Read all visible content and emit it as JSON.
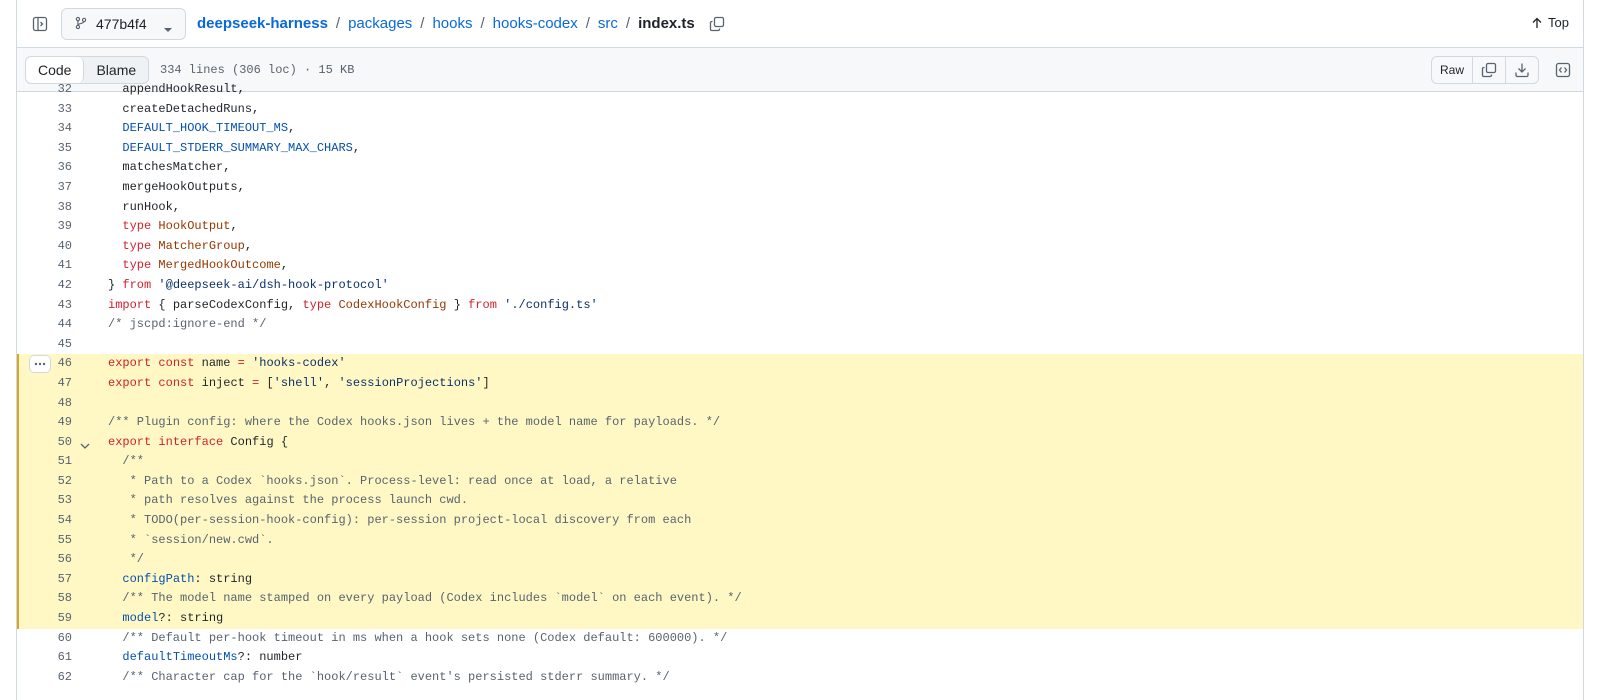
{
  "repo": "deepseek-harness",
  "branch": "477b4f4",
  "breadcrumbs": [
    "packages",
    "hooks",
    "hooks-codex",
    "src"
  ],
  "current_file": "index.ts",
  "top_label": "Top",
  "tabs": [
    "Code",
    "Blame"
  ],
  "file_info": "334 lines (306 loc) · 15 KB",
  "raw_label": "Raw",
  "colors": {
    "keyword": "#cf222e",
    "constant": "#0550ae",
    "type": "#953800",
    "string": "#0a3069",
    "comment": "#59636e",
    "highlight_bg": "#fff8c5",
    "link": "#0969da"
  },
  "icons": [
    "sidebar-collapse-icon",
    "git-branch-icon",
    "chevron-down-icon",
    "copy-icon",
    "arrow-up-icon",
    "download-icon",
    "symbols-icon",
    "kebab-horizontal-icon"
  ],
  "highlight_range": [
    46,
    59
  ],
  "code_lines": [
    {
      "n": "32",
      "tokens": [
        [
          "pln",
          "  appendHookResult,"
        ]
      ]
    },
    {
      "n": "33",
      "tokens": [
        [
          "pln",
          "  createDetachedRuns,"
        ]
      ]
    },
    {
      "n": "34",
      "tokens": [
        [
          "pln",
          "  "
        ],
        [
          "const",
          "DEFAULT_HOOK_TIMEOUT_MS"
        ],
        [
          "pln",
          ","
        ]
      ]
    },
    {
      "n": "35",
      "tokens": [
        [
          "pln",
          "  "
        ],
        [
          "const",
          "DEFAULT_STDERR_SUMMARY_MAX_CHARS"
        ],
        [
          "pln",
          ","
        ]
      ]
    },
    {
      "n": "36",
      "tokens": [
        [
          "pln",
          "  matchesMatcher,"
        ]
      ]
    },
    {
      "n": "37",
      "tokens": [
        [
          "pln",
          "  mergeHookOutputs,"
        ]
      ]
    },
    {
      "n": "38",
      "tokens": [
        [
          "pln",
          "  runHook,"
        ]
      ]
    },
    {
      "n": "39",
      "tokens": [
        [
          "pln",
          "  "
        ],
        [
          "kw",
          "type"
        ],
        [
          "pln",
          " "
        ],
        [
          "type",
          "HookOutput"
        ],
        [
          "pln",
          ","
        ]
      ]
    },
    {
      "n": "40",
      "tokens": [
        [
          "pln",
          "  "
        ],
        [
          "kw",
          "type"
        ],
        [
          "pln",
          " "
        ],
        [
          "type",
          "MatcherGroup"
        ],
        [
          "pln",
          ","
        ]
      ]
    },
    {
      "n": "41",
      "tokens": [
        [
          "pln",
          "  "
        ],
        [
          "kw",
          "type"
        ],
        [
          "pln",
          " "
        ],
        [
          "type",
          "MergedHookOutcome"
        ],
        [
          "pln",
          ","
        ]
      ]
    },
    {
      "n": "42",
      "tokens": [
        [
          "pln",
          "} "
        ],
        [
          "kw",
          "from"
        ],
        [
          "pln",
          " "
        ],
        [
          "str",
          "'@deepseek-ai/dsh-hook-protocol'"
        ]
      ]
    },
    {
      "n": "43",
      "tokens": [
        [
          "kw",
          "import"
        ],
        [
          "pln",
          " { parseCodexConfig, "
        ],
        [
          "kw",
          "type"
        ],
        [
          "pln",
          " "
        ],
        [
          "type",
          "CodexHookConfig"
        ],
        [
          "pln",
          " } "
        ],
        [
          "kw",
          "from"
        ],
        [
          "pln",
          " "
        ],
        [
          "str",
          "'./config.ts'"
        ]
      ]
    },
    {
      "n": "44",
      "tokens": [
        [
          "com",
          "/* jscpd:ignore-end */"
        ]
      ]
    },
    {
      "n": "45",
      "tokens": []
    },
    {
      "n": "46",
      "tokens": [
        [
          "kw",
          "export"
        ],
        [
          "pln",
          " "
        ],
        [
          "kw",
          "const"
        ],
        [
          "pln",
          " name "
        ],
        [
          "kw",
          "="
        ],
        [
          "pln",
          " "
        ],
        [
          "str",
          "'hooks-codex'"
        ]
      ]
    },
    {
      "n": "47",
      "tokens": [
        [
          "kw",
          "export"
        ],
        [
          "pln",
          " "
        ],
        [
          "kw",
          "const"
        ],
        [
          "pln",
          " inject "
        ],
        [
          "kw",
          "="
        ],
        [
          "pln",
          " ["
        ],
        [
          "str",
          "'shell'"
        ],
        [
          "pln",
          ", "
        ],
        [
          "str",
          "'sessionProjections'"
        ],
        [
          "pln",
          "]"
        ]
      ]
    },
    {
      "n": "48",
      "tokens": []
    },
    {
      "n": "49",
      "tokens": [
        [
          "com",
          "/** Plugin config: where the Codex hooks.json lives + the model name for payloads. */"
        ]
      ]
    },
    {
      "n": "50",
      "fold": true,
      "tokens": [
        [
          "kw",
          "export"
        ],
        [
          "pln",
          " "
        ],
        [
          "kw",
          "interface"
        ],
        [
          "pln",
          " Config {"
        ]
      ]
    },
    {
      "n": "51",
      "tokens": [
        [
          "com",
          "  /**"
        ]
      ]
    },
    {
      "n": "52",
      "tokens": [
        [
          "com",
          "   * Path to a Codex `hooks.json`. Process-level: read once at load, a relative"
        ]
      ]
    },
    {
      "n": "53",
      "tokens": [
        [
          "com",
          "   * path resolves against the process launch cwd."
        ]
      ]
    },
    {
      "n": "54",
      "tokens": [
        [
          "com",
          "   * TODO(per-session-hook-config): per-session project-local discovery from each"
        ]
      ]
    },
    {
      "n": "55",
      "tokens": [
        [
          "com",
          "   * `session/new.cwd`."
        ]
      ]
    },
    {
      "n": "56",
      "tokens": [
        [
          "com",
          "   */"
        ]
      ]
    },
    {
      "n": "57",
      "tokens": [
        [
          "pln",
          "  "
        ],
        [
          "const",
          "configPath"
        ],
        [
          "pln",
          ": string"
        ]
      ]
    },
    {
      "n": "58",
      "tokens": [
        [
          "com",
          "  /** The model name stamped on every payload (Codex includes `model` on each event). */"
        ]
      ]
    },
    {
      "n": "59",
      "tokens": [
        [
          "pln",
          "  "
        ],
        [
          "const",
          "model"
        ],
        [
          "pln",
          "?: string"
        ]
      ]
    },
    {
      "n": "60",
      "tokens": [
        [
          "com",
          "  /** Default per-hook timeout in ms when a hook sets none (Codex default: 600000). */"
        ]
      ]
    },
    {
      "n": "61",
      "tokens": [
        [
          "pln",
          "  "
        ],
        [
          "const",
          "defaultTimeoutMs"
        ],
        [
          "pln",
          "?: number"
        ]
      ]
    },
    {
      "n": "62",
      "tokens": [
        [
          "com",
          "  /** Character cap for the `hook/result` event's persisted stderr summary. */"
        ]
      ]
    }
  ]
}
